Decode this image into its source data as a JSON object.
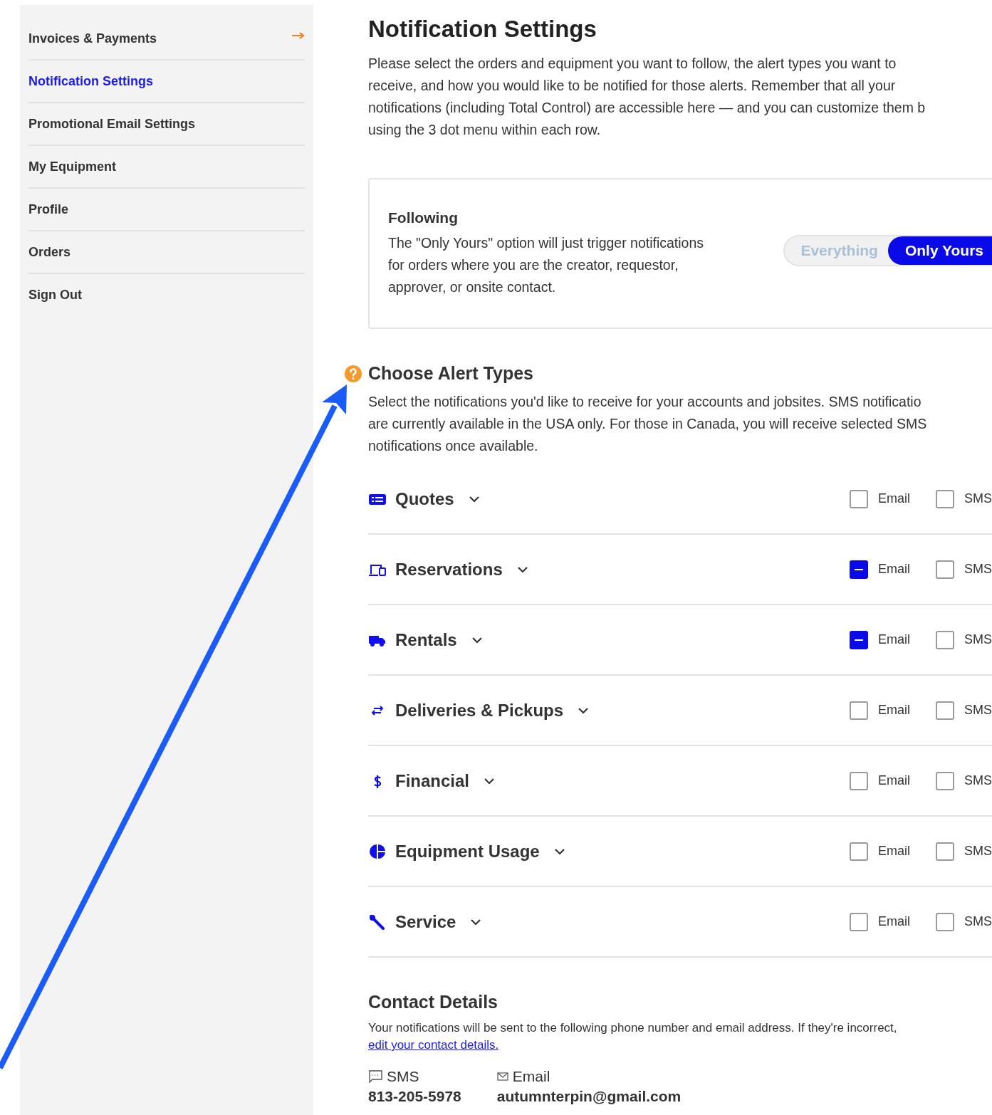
{
  "sidebar": {
    "items": [
      {
        "label": "Invoices & Payments",
        "selected": false,
        "external": true
      },
      {
        "label": "Notification Settings",
        "selected": true,
        "external": false
      },
      {
        "label": "Promotional Email Settings",
        "selected": false,
        "external": false
      },
      {
        "label": "My Equipment",
        "selected": false,
        "external": false
      },
      {
        "label": "Profile",
        "selected": false,
        "external": false
      },
      {
        "label": "Orders",
        "selected": false,
        "external": false
      },
      {
        "label": "Sign Out",
        "selected": false,
        "external": false
      }
    ]
  },
  "page": {
    "title": "Notification Settings",
    "intro": "Please select the orders and equipment you want to follow, the alert types you want to\nreceive, and how you would like to be notified for those alerts. Remember that all your\nnotifications (including Total Control) are accessible here — and you can customize them b\nusing the 3 dot menu within each row."
  },
  "following": {
    "title": "Following",
    "description": "The \"Only Yours\" option will just trigger notifications\nfor orders where you are the creator, requestor,\napprover, or onsite contact.",
    "options": [
      {
        "label": "Everything",
        "selected": false
      },
      {
        "label": "Only Yours",
        "selected": true
      }
    ]
  },
  "alert_types": {
    "title": "Choose Alert Types",
    "description": "Select the notifications you'd like to receive for your accounts and jobsites. SMS notificatio\nare currently available in the USA only. For those in Canada, you will receive selected SMS\nnotifications once available.",
    "rows": [
      {
        "label": "Quotes",
        "channels": [
          {
            "label": "Email",
            "checked": false
          },
          {
            "label": "SMS",
            "checked": false
          }
        ]
      },
      {
        "label": "Reservations",
        "channels": [
          {
            "label": "Email",
            "checked": true
          },
          {
            "label": "SMS",
            "checked": false
          }
        ]
      },
      {
        "label": "Rentals",
        "channels": [
          {
            "label": "Email",
            "checked": true
          },
          {
            "label": "SMS",
            "checked": false
          }
        ]
      },
      {
        "label": "Deliveries & Pickups",
        "channels": [
          {
            "label": "Email",
            "checked": false
          },
          {
            "label": "SMS",
            "checked": false
          }
        ]
      },
      {
        "label": "Financial",
        "channels": [
          {
            "label": "Email",
            "checked": false
          },
          {
            "label": "SMS",
            "checked": false
          }
        ]
      },
      {
        "label": "Equipment Usage",
        "channels": [
          {
            "label": "Email",
            "checked": false
          },
          {
            "label": "SMS",
            "checked": false
          }
        ]
      },
      {
        "label": "Service",
        "channels": [
          {
            "label": "Email",
            "checked": false
          },
          {
            "label": "SMS",
            "checked": false
          }
        ]
      }
    ]
  },
  "contact": {
    "title": "Contact Details",
    "description": "Your notifications will be sent to the following phone number and email address. If they're incorrect,",
    "link": "edit your contact details.",
    "methods": [
      {
        "kind": "sms",
        "label": "SMS",
        "value": "813-205-5978"
      },
      {
        "kind": "email",
        "label": "Email",
        "value": "autumnterpin@gmail.com"
      }
    ]
  }
}
